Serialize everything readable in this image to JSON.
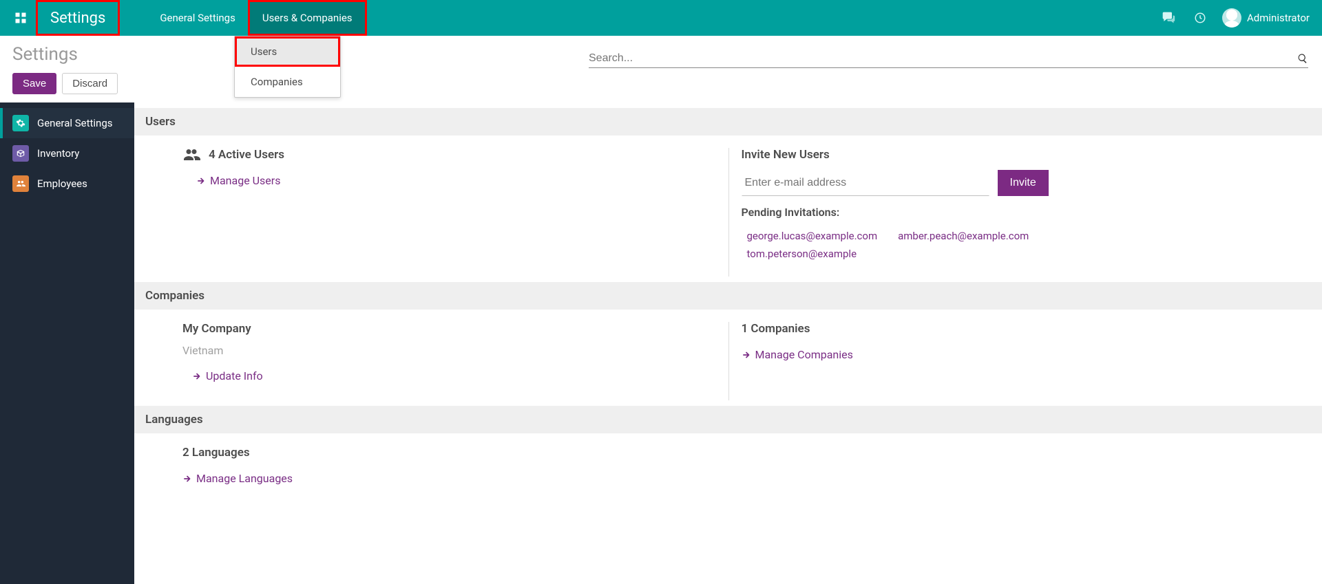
{
  "navbar": {
    "brand": "Settings",
    "items": [
      {
        "label": "General Settings"
      },
      {
        "label": "Users & Companies"
      }
    ],
    "user_name": "Administrator"
  },
  "dropdown": {
    "items": [
      {
        "label": "Users"
      },
      {
        "label": "Companies"
      }
    ]
  },
  "breadcrumb": "Settings",
  "buttons": {
    "save": "Save",
    "discard": "Discard",
    "invite": "Invite"
  },
  "search": {
    "placeholder": "Search..."
  },
  "sidebar": {
    "items": [
      {
        "label": "General Settings"
      },
      {
        "label": "Inventory"
      },
      {
        "label": "Employees"
      }
    ]
  },
  "sections": {
    "users": {
      "title": "Users",
      "active_users": "4 Active Users",
      "manage_link": "Manage Users",
      "invite_title": "Invite New Users",
      "invite_placeholder": "Enter e-mail address",
      "pending_title": "Pending Invitations:",
      "pending": [
        "george.lucas@example.com",
        "amber.peach@example.com",
        "tom.peterson@example"
      ]
    },
    "companies": {
      "title": "Companies",
      "my_company_label": "My Company",
      "my_company_location": "Vietnam",
      "update_link": "Update Info",
      "count": "1 Companies",
      "manage_link": "Manage Companies"
    },
    "languages": {
      "title": "Languages",
      "count": "2 Languages",
      "manage_link": "Manage Languages"
    }
  }
}
